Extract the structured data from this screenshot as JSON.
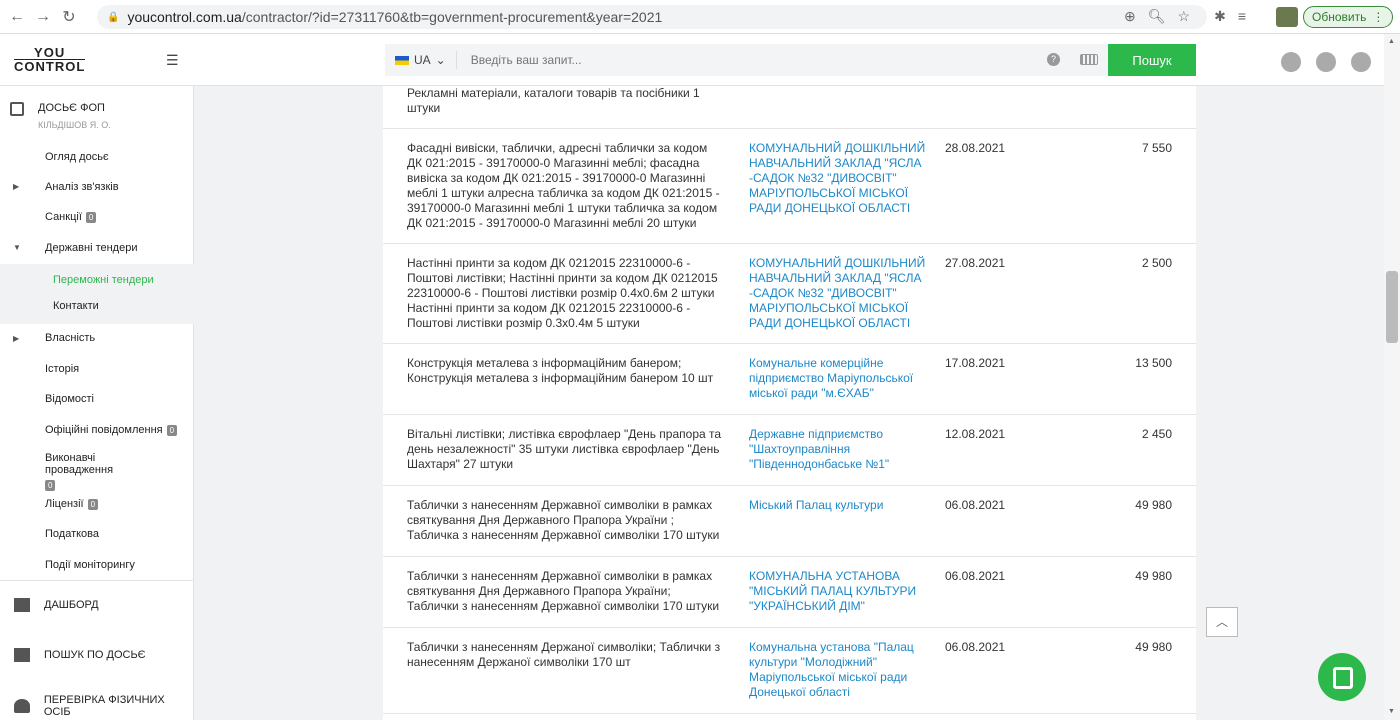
{
  "browser": {
    "url_host": "youcontrol.com.ua",
    "url_path": "/contractor/?id=27311760&tb=government-procurement&year=2021",
    "update_label": "Обновить"
  },
  "header": {
    "logo_line1": "YOU",
    "logo_line2": "CONTROL",
    "lang": "UA",
    "search_placeholder": "Введіть ваш запит...",
    "search_button": "Пошук"
  },
  "sidebar": {
    "dossier_title": "ДОСЬЄ ФОП",
    "dossier_sub": "КІЛЬДІШОВ Я. О.",
    "items": [
      {
        "label": "Огляд досьє"
      },
      {
        "label": "Аналіз зв'язків"
      },
      {
        "label": "Санкції",
        "badge": "0"
      },
      {
        "label": "Державні тендери"
      },
      {
        "label": "Переможні тендери"
      },
      {
        "label": "Контакти"
      },
      {
        "label": "Власність"
      },
      {
        "label": "Історія"
      },
      {
        "label": "Відомості"
      },
      {
        "label": "Офіційні повідомлення",
        "badge": "0"
      },
      {
        "label": "Виконавчі провадження",
        "badge": "0"
      },
      {
        "label": "Ліцензії",
        "badge": "0"
      },
      {
        "label": "Податкова"
      },
      {
        "label": "Події моніторингу"
      }
    ],
    "dashboard": "ДАШБОРД",
    "search_dossier": "ПОШУК ПО ДОСЬЄ",
    "check_persons": "ПЕРЕВІРКА ФІЗИЧНИХ ОСІБ"
  },
  "rows": [
    {
      "desc": "Рекламні матеріали, каталоги товарів та посібники 1 штуки",
      "org": "",
      "date": "",
      "amount": ""
    },
    {
      "desc": "Фасадні вивіски, таблички, адресні таблички за кодом ДК 021:2015 - 39170000-0 Магазинні меблі; фасадна вивіска за кодом ДК 021:2015 - 39170000-0 Магазинні меблі 1 штуки алресна табличка за кодом ДК 021:2015 - 39170000-0 Магазинні меблі 1 штуки табличка за кодом ДК 021:2015 - 39170000-0 Магазинні меблі 20 штуки",
      "org": "КОМУНАЛЬНИЙ ДОШКІЛЬНИЙ НАВЧАЛЬНИЙ ЗАКЛАД \"ЯСЛА -САДОК №32 \"ДИВОСВІТ\" МАРІУПОЛЬСЬКОЇ МІСЬКОЇ РАДИ ДОНЕЦЬКОЇ ОБЛАСТІ",
      "date": "28.08.2021",
      "amount": "7 550"
    },
    {
      "desc": "Настінні принти за кодом ДК 0212015 22310000-6 - Поштові листівки; Настінні принти за кодом ДК 0212015 22310000-6 - Поштові листівки розмір 0.4x0.6м 2 штуки Настінні принти за кодом ДК 0212015 22310000-6 - Поштові листівки розмір 0.3x0.4м 5 штуки",
      "org": "КОМУНАЛЬНИЙ ДОШКІЛЬНИЙ НАВЧАЛЬНИЙ ЗАКЛАД \"ЯСЛА -САДОК №32 \"ДИВОСВІТ\" МАРІУПОЛЬСЬКОЇ МІСЬКОЇ РАДИ ДОНЕЦЬКОЇ ОБЛАСТІ",
      "date": "27.08.2021",
      "amount": "2 500"
    },
    {
      "desc": "Конструкція металева з інформаційним банером; Конструкція металева з інформаційним банером 10 шт",
      "org": "Комунальне комерційне підприємство Маріупольської міської ради \"м.ЄХАБ\"",
      "date": "17.08.2021",
      "amount": "13 500"
    },
    {
      "desc": "Вітальні листівки; листівка єврофлаер \"День прапора та день незалежності\" 35 штуки листівка єврофлаер \"День Шахтаря\" 27 штуки",
      "org": "Державне підприємство \"Шахтоуправління \"Південнодонбаське №1\"",
      "date": "12.08.2021",
      "amount": "2 450"
    },
    {
      "desc": "Таблички з нанесенням Державної символіки в рамках святкування Дня Державного Прапора України ; Табличка з нанесенням Державної символіки 170 штуки",
      "org": "Міський Палац культури",
      "date": "06.08.2021",
      "amount": "49 980"
    },
    {
      "desc": "Таблички з нанесенням Державної символіки в рамках святкування Дня Державного Прапора України; Таблички з нанесенням Державної символіки 170 штуки",
      "org": "КОМУНАЛЬНА УСТАНОВА \"МІСЬКИЙ ПАЛАЦ КУЛЬТУРИ \"УКРАЇНСЬКИЙ ДІМ\"",
      "date": "06.08.2021",
      "amount": "49 980"
    },
    {
      "desc": "Таблички з нанесенням Держаної символіки; Таблички з нанесенням Держаної символіки 170 шт",
      "org": "Комунальна установа \"Палац культури \"Молодіжний\" Маріупольської міської ради Донецької області",
      "date": "06.08.2021",
      "amount": "49 980"
    }
  ],
  "colors": {
    "accent": "#2db84b",
    "link": "#1e88c8"
  }
}
